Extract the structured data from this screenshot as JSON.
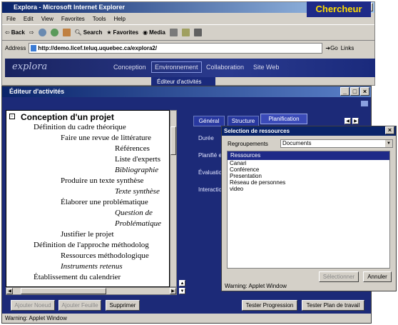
{
  "browser": {
    "title": "Explora - Microsoft Internet Explorer",
    "menu": [
      "File",
      "Edit",
      "View",
      "Favorites",
      "Tools",
      "Help"
    ],
    "toolbar": {
      "back": "Back",
      "search": "Search",
      "favorites": "Favorites",
      "media": "Media"
    },
    "address_label": "Address",
    "address_value": "http://demo.licef.teluq.uquebec.ca/explora2/",
    "go": "Go",
    "links": "Links"
  },
  "site": {
    "logo": "explora",
    "nav": [
      "Conception",
      "Environnement",
      "Collaboration",
      "Site Web"
    ],
    "role": "Chercheur",
    "dropdown_item": "Éditeur d'activités"
  },
  "editor": {
    "title": "Éditeur d'activités",
    "tree": [
      {
        "text": "Conception d'un projet",
        "level": 0,
        "italic": false
      },
      {
        "text": "Définition du cadre théorique",
        "level": 1,
        "italic": false
      },
      {
        "text": "Faire une revue de littérature",
        "level": 2,
        "italic": false
      },
      {
        "text": "Références",
        "level": 3,
        "italic": false
      },
      {
        "text": "Liste d'experts",
        "level": 3,
        "italic": false
      },
      {
        "text": "Bibliographie",
        "level": 3,
        "italic": true
      },
      {
        "text": "Produire un texte synthèse",
        "level": 2,
        "italic": false
      },
      {
        "text": "Texte synthèse",
        "level": 3,
        "italic": true
      },
      {
        "text": "Élaborer une problématique",
        "level": 2,
        "italic": false
      },
      {
        "text": "Question de",
        "level": 3,
        "italic": true
      },
      {
        "text": "Problématique",
        "level": 3,
        "italic": true
      },
      {
        "text": "Justifier le projet",
        "level": 2,
        "italic": false
      },
      {
        "text": "Définition de l'approche méthodolog",
        "level": 1,
        "italic": false
      },
      {
        "text": "Ressources méthodologique",
        "level": 2,
        "italic": false
      },
      {
        "text": "Instruments retenus",
        "level": 2,
        "italic": true
      },
      {
        "text": "Établissement du calendrier",
        "level": 1,
        "italic": false
      }
    ],
    "tabs": [
      "Général",
      "Structure",
      "Planification"
    ],
    "fields": [
      "Durée",
      "Planifié e",
      "Évaluatio",
      "Interactio"
    ],
    "buttons": {
      "add_node": "Ajouter Noeud",
      "add_leaf": "Ajouter Feuille",
      "delete": "Supprimer",
      "test_progression": "Tester Progression",
      "test_plan": "Tester Plan de travail"
    },
    "status": "Warning: Applet Window"
  },
  "selection_dialog": {
    "title": "Selection de ressources",
    "group_label": "Regroupements",
    "group_value": "Documents",
    "list_header": "Ressources",
    "items": [
      "Canari",
      "Conférence",
      "Presentation",
      "Réseau de personnes",
      "video"
    ],
    "select_button": "Sélectionner",
    "cancel_button": "Annuler",
    "status": "Warning: Applet Window"
  }
}
